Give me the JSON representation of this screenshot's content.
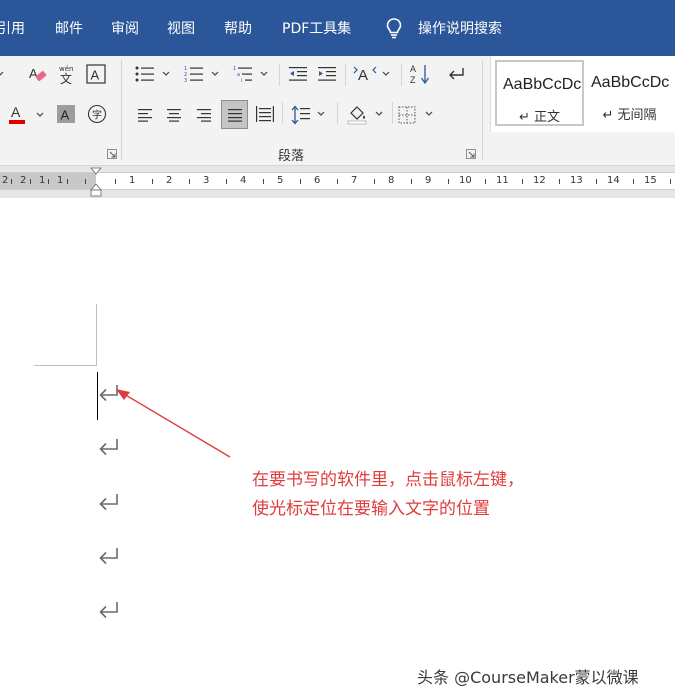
{
  "menu": {
    "tabs": [
      "引用",
      "邮件",
      "审阅",
      "视图",
      "帮助",
      "PDF工具集"
    ],
    "tell_me": "操作说明搜索",
    "accent": "#2b579a"
  },
  "ribbon": {
    "paragraph_group_label": "段落",
    "styles": [
      {
        "sample": "AaBbCcDc",
        "name": "↵ 正文"
      },
      {
        "sample": "AaBbCcDc",
        "name": "↵ 无间隔"
      }
    ],
    "icons": [
      "clear-formatting-icon",
      "phonetic-guide-icon",
      "character-border-icon",
      "font-color-icon",
      "character-shading-icon",
      "enclose-characters-icon",
      "bullets-icon",
      "numbering-icon",
      "multilevel-list-icon",
      "decrease-indent-icon",
      "increase-indent-icon",
      "character-scaling-icon",
      "sort-icon",
      "show-marks-icon",
      "align-left-icon",
      "center-icon",
      "align-right-icon",
      "justify-icon",
      "distributed-icon",
      "line-spacing-icon",
      "shading-icon",
      "borders-icon"
    ]
  },
  "ruler": {
    "left_labels": [
      "2",
      "1",
      "1"
    ],
    "labels": [
      "1",
      "2",
      "3",
      "4",
      "5",
      "6",
      "7",
      "8",
      "9",
      "10",
      "11",
      "12",
      "13",
      "14",
      "15"
    ]
  },
  "document": {
    "annotation_line1": "在要书写的软件里，点击鼠标左键，",
    "annotation_line2": "使光标定位在要输入文字的位置",
    "annotation_color": "#e03c3c",
    "paragraph_marks": 5
  },
  "watermark": "头条 @CourseMaker蒙以微课"
}
